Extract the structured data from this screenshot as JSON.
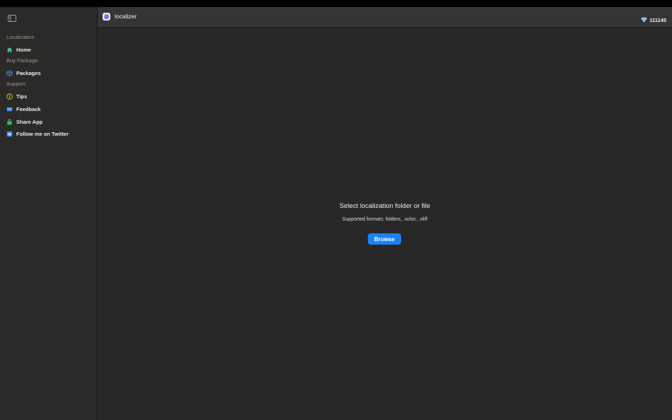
{
  "app": {
    "title": "localizer",
    "gem_count": "111145"
  },
  "sidebar": {
    "sections": [
      {
        "label": "Localization"
      },
      {
        "label": "Buy Package:"
      },
      {
        "label": "Support:"
      }
    ],
    "items": [
      {
        "label": "Home",
        "icon": "home-icon"
      },
      {
        "label": "Packages",
        "icon": "package-icon"
      },
      {
        "label": "Tips",
        "icon": "info-icon"
      },
      {
        "label": "Feedback",
        "icon": "mail-icon"
      },
      {
        "label": "Share App",
        "icon": "share-icon"
      },
      {
        "label": "Follow me on Twitter",
        "icon": "twitter-icon"
      }
    ]
  },
  "main": {
    "prompt_title": "Select localization folder or file",
    "prompt_subtitle": "Supported formats: folders, .xcloc, .xliff",
    "browse_label": "Browse"
  },
  "colors": {
    "accent": "#1a82f4",
    "sidebar_bg": "#2b2a28",
    "main_bg": "#282828",
    "titlebar_bg": "#353535"
  }
}
